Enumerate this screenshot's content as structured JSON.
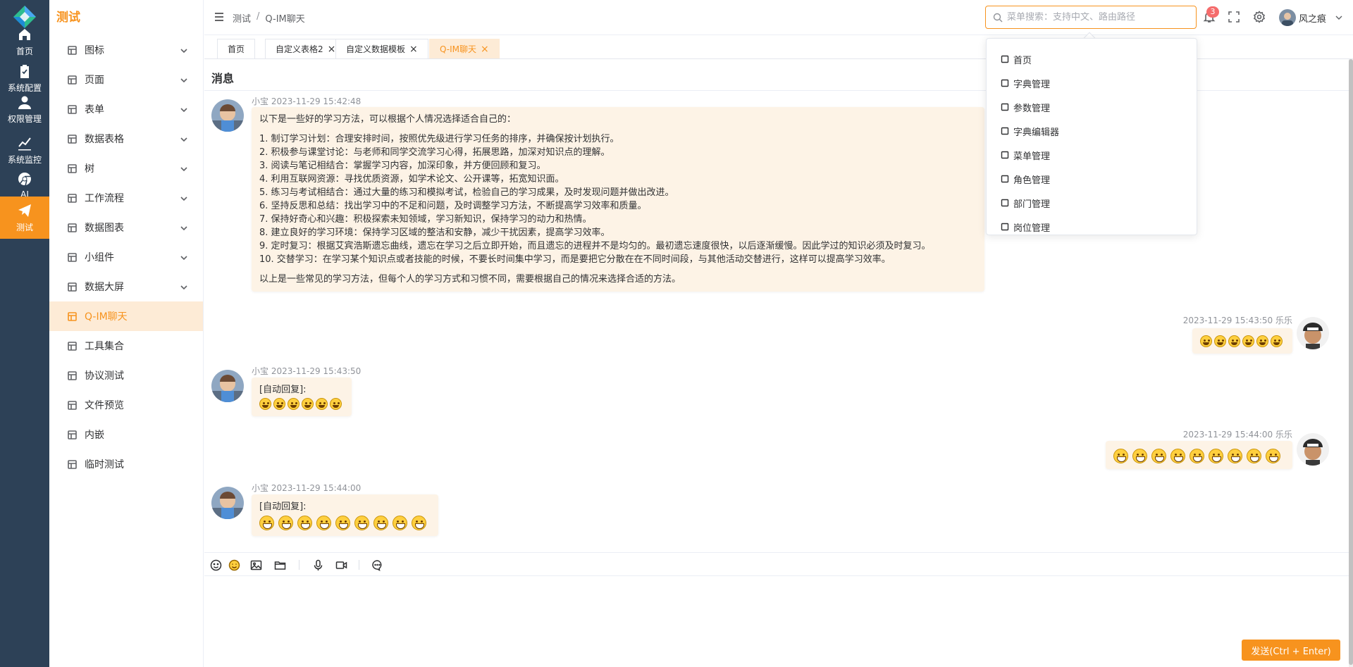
{
  "rail": {
    "items": [
      {
        "label": "首页",
        "icon": "home-icon"
      },
      {
        "label": "系统配置",
        "icon": "clipboard-icon"
      },
      {
        "label": "权限管理",
        "icon": "user-icon"
      },
      {
        "label": "系统监控",
        "icon": "chart-line-icon"
      },
      {
        "label": "AI",
        "icon": "chrome-icon"
      },
      {
        "label": "测试",
        "icon": "paper-plane-icon"
      }
    ]
  },
  "menu": {
    "title": "测试",
    "items": [
      {
        "label": "图标",
        "icon": "table-icon",
        "expandable": true
      },
      {
        "label": "页面",
        "icon": "monitor-icon",
        "expandable": true
      },
      {
        "label": "表单",
        "icon": "form-icon",
        "expandable": true
      },
      {
        "label": "数据表格",
        "icon": "grid-icon",
        "expandable": true
      },
      {
        "label": "树",
        "icon": "tree-icon",
        "expandable": true
      },
      {
        "label": "工作流程",
        "icon": "share-icon",
        "expandable": true
      },
      {
        "label": "数据图表",
        "icon": "pie-icon",
        "expandable": true
      },
      {
        "label": "小组件",
        "icon": "cpu-icon",
        "expandable": true
      },
      {
        "label": "数据大屏",
        "icon": "screen-icon",
        "expandable": true
      },
      {
        "label": "Q-IM聊天",
        "icon": "chat-icon",
        "expandable": false
      },
      {
        "label": "工具集合",
        "icon": "doc-icon",
        "expandable": false
      },
      {
        "label": "协议测试",
        "icon": "truck-icon",
        "expandable": false
      },
      {
        "label": "文件预览",
        "icon": "preview-icon",
        "expandable": false
      },
      {
        "label": "内嵌",
        "icon": "compass-icon",
        "expandable": false
      },
      {
        "label": "临时测试",
        "icon": "ticket-icon",
        "expandable": false
      }
    ]
  },
  "header": {
    "breadcrumb": [
      "测试",
      "Q-IM聊天"
    ],
    "breadcrumb_sep": "/",
    "search_placeholder": "菜单搜索：支持中文、路由路径",
    "badge": "3",
    "username": "风之痕"
  },
  "tabs": [
    {
      "label": "首页",
      "closable": false
    },
    {
      "label": "自定义表格2",
      "closable": true
    },
    {
      "label": "自定义数据模板",
      "closable": true
    },
    {
      "label": "Q-IM聊天",
      "closable": true
    }
  ],
  "chat": {
    "title": "消息",
    "messages": [
      {
        "side": "left",
        "sender": "小宝",
        "time": "2023-11-29 15:42:48",
        "intro": "以下是一些好的学习方法，可以根据个人情况选择适合自己的：",
        "lines": [
          "1. 制订学习计划：合理安排时间，按照优先级进行学习任务的排序，并确保按计划执行。",
          "2. 积极参与课堂讨论：与老师和同学交流学习心得，拓展思路，加深对知识点的理解。",
          "3. 阅读与笔记相结合：掌握学习内容，加深印象，并方便回顾和复习。",
          "4. 利用互联网资源：寻找优质资源，如学术论文、公开课等，拓宽知识面。",
          "5. 练习与考试相结合：通过大量的练习和模拟考试，检验自己的学习成果，及时发现问题并做出改进。",
          "6. 坚持反思和总结：找出学习中的不足和问题，及时调整学习方法，不断提高学习效率和质量。",
          "7. 保持好奇心和兴趣：积极探索未知领域，学习新知识，保持学习的动力和热情。",
          "8. 建立良好的学习环境：保持学习区域的整洁和安静，减少干扰因素，提高学习效率。",
          "9. 定时复习：根据艾宾浩斯遗忘曲线，遗忘在学习之后立即开始，而且遗忘的进程并不是均匀的。最初遗忘速度很快，以后逐渐缓慢。因此学过的知识必须及时复习。",
          "10. 交替学习：在学习某个知识点或者技能的时候，不要长时间集中学习，而是要把它分散在在不同时间段，与其他活动交替进行，这样可以提高学习效率。"
        ],
        "outro": "以上是一些常见的学习方法，但每个人的学习方式和习惯不同，需要根据自己的情况来选择合适的方法。"
      },
      {
        "side": "right",
        "sender": "乐乐",
        "time": "2023-11-29 15:43:50",
        "emoji_count": 6,
        "emoji_size": "small"
      },
      {
        "side": "left",
        "sender": "小宝",
        "time": "2023-11-29 15:43:50",
        "text": "[自动回复]:",
        "emoji_count": 6,
        "emoji_size": "small"
      },
      {
        "side": "right",
        "sender": "乐乐",
        "time": "2023-11-29 15:44:00",
        "emoji_count": 9,
        "emoji_size": "big"
      },
      {
        "side": "left",
        "sender": "小宝",
        "time": "2023-11-29 15:44:00",
        "text": "[自动回复]:",
        "emoji_count": 9,
        "emoji_size": "big"
      }
    ],
    "send_label": "发送(Ctrl + Enter)"
  },
  "dropdown": {
    "items": [
      {
        "label": "首页",
        "icon": "home-icon"
      },
      {
        "label": "字典管理",
        "icon": "book-icon"
      },
      {
        "label": "参数管理",
        "icon": "document-icon"
      },
      {
        "label": "字典编辑器",
        "icon": "pen-icon"
      },
      {
        "label": "菜单管理",
        "icon": "menu-grid-icon"
      },
      {
        "label": "角色管理",
        "icon": "camera-icon"
      },
      {
        "label": "部门管理",
        "icon": "building-icon"
      },
      {
        "label": "岗位管理",
        "icon": "headset-icon"
      }
    ]
  },
  "colors": {
    "accent": "#f7931e",
    "rail": "#2d4157",
    "bubble": "#fdf3e6",
    "active_bg": "#fdebd6"
  }
}
